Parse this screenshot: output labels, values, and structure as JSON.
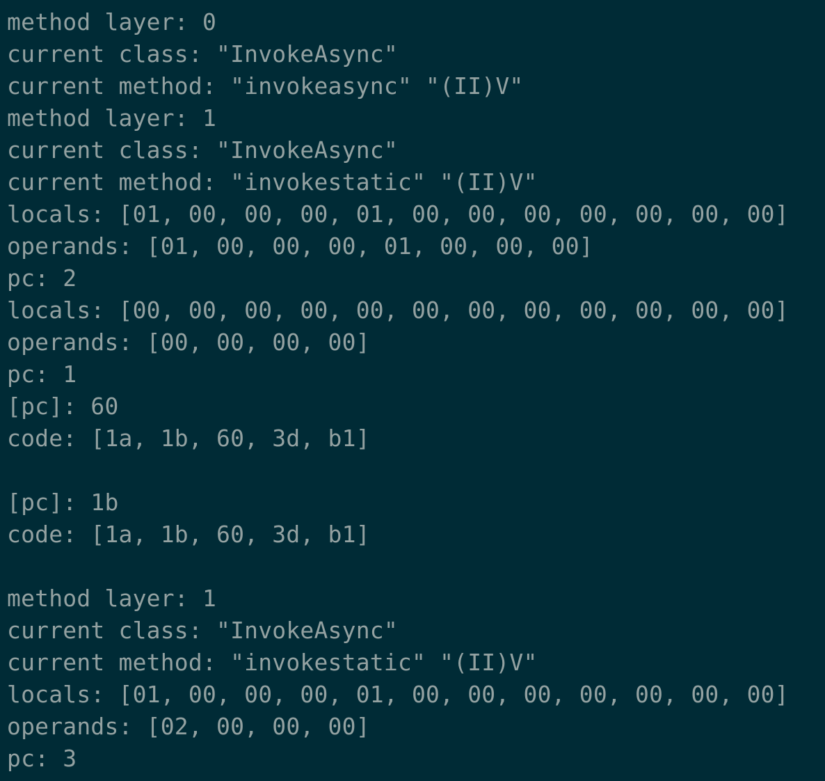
{
  "colors": {
    "background": "#002b36",
    "text": "#93a1a1"
  },
  "terminal": {
    "lines": [
      "method layer: 0",
      "current class: \"InvokeAsync\"",
      "current method: \"invokeasync\" \"(II)V\"",
      "method layer: 1",
      "current class: \"InvokeAsync\"",
      "current method: \"invokestatic\" \"(II)V\"",
      "locals: [01, 00, 00, 00, 01, 00, 00, 00, 00, 00, 00, 00]",
      "operands: [01, 00, 00, 00, 01, 00, 00, 00]",
      "pc: 2",
      "locals: [00, 00, 00, 00, 00, 00, 00, 00, 00, 00, 00, 00]",
      "operands: [00, 00, 00, 00]",
      "pc: 1",
      "[pc]: 60",
      "code: [1a, 1b, 60, 3d, b1]",
      "",
      "[pc]: 1b",
      "code: [1a, 1b, 60, 3d, b1]",
      "",
      "method layer: 1",
      "current class: \"InvokeAsync\"",
      "current method: \"invokestatic\" \"(II)V\"",
      "locals: [01, 00, 00, 00, 01, 00, 00, 00, 00, 00, 00, 00]",
      "operands: [02, 00, 00, 00]",
      "pc: 3"
    ]
  }
}
